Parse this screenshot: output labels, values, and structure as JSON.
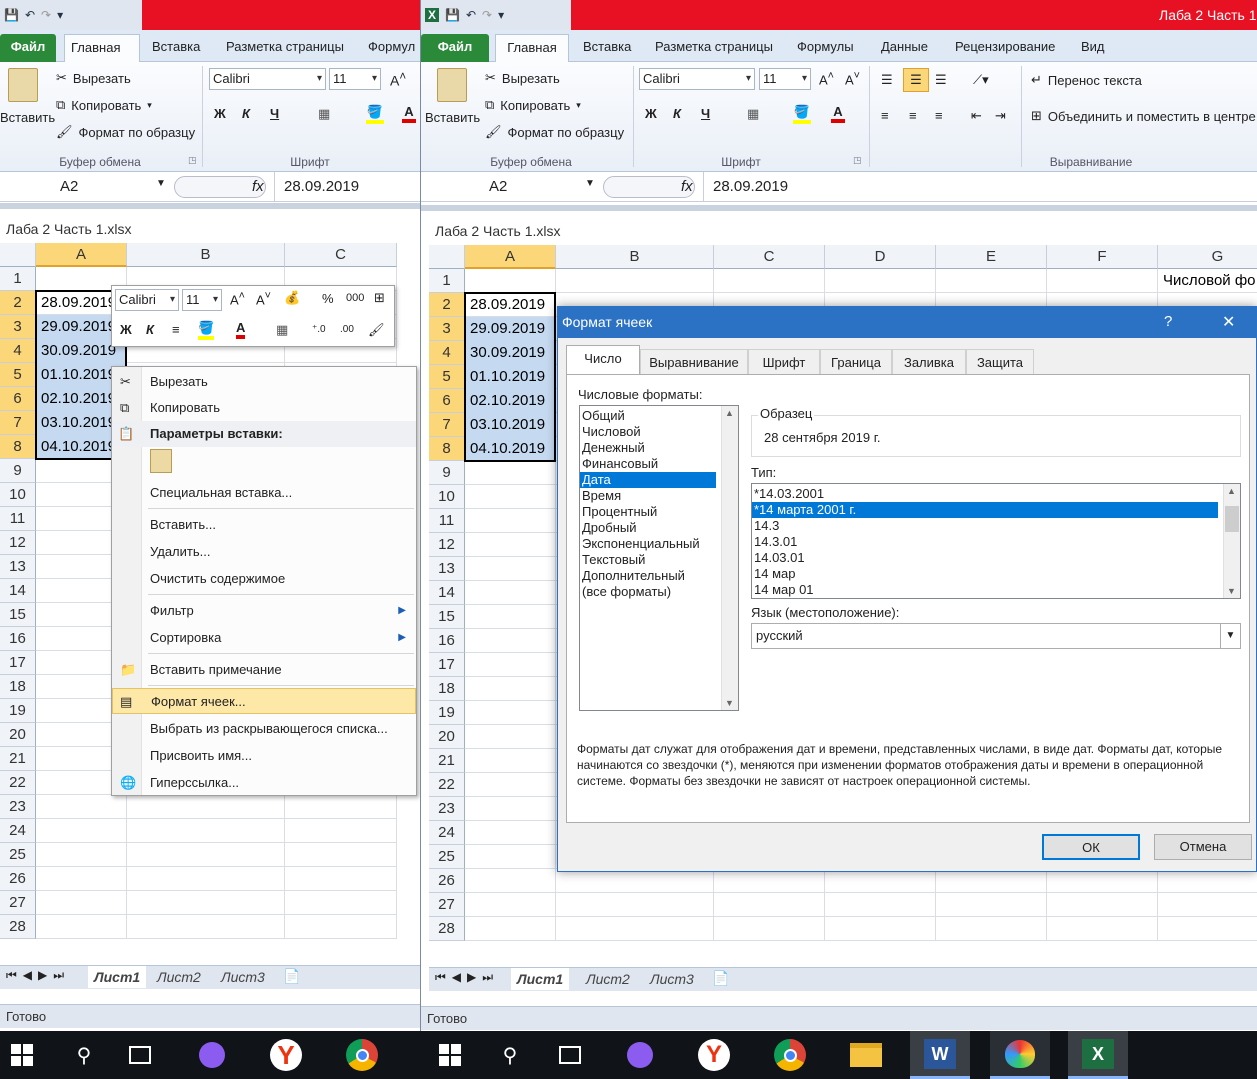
{
  "left": {
    "ribbon_tabs": [
      "Файл",
      "Главная",
      "Вставка",
      "Разметка страницы",
      "Формул"
    ],
    "clipboard": {
      "paste": "Вставить",
      "cut": "Вырезать",
      "copy": "Копировать",
      "format_painter": "Формат по образцу",
      "group": "Буфер обмена"
    },
    "font": {
      "name": "Calibri",
      "size": "11",
      "bold": "Ж",
      "italic": "К",
      "underline": "Ч",
      "group": "Шрифт"
    },
    "name_box": "A2",
    "fx": "fx",
    "formula": "28.09.2019",
    "workbook_title": "Лаба 2 Часть 1.xlsx",
    "columns": [
      "A",
      "B",
      "C"
    ],
    "rows": [
      "1",
      "2",
      "3",
      "4",
      "5",
      "6",
      "7",
      "8",
      "9",
      "10",
      "11",
      "12",
      "13",
      "14",
      "15",
      "16",
      "17",
      "18",
      "19",
      "20",
      "21",
      "22",
      "23",
      "24",
      "25",
      "26",
      "27",
      "28"
    ],
    "cells": [
      "28.09.2019",
      "29.09.2019",
      "30.09.2019",
      "01.10.2019",
      "02.10.2019",
      "03.10.2019",
      "04.10.2019"
    ],
    "sheet_tabs": [
      "Лист1",
      "Лист2",
      "Лист3"
    ],
    "status": "Готово",
    "mini_toolbar": {
      "font": "Calibri",
      "size": "11",
      "percent": "%",
      "thousands": "000",
      "bold": "Ж",
      "italic": "К"
    },
    "context_menu": [
      "Вырезать",
      "Копировать",
      "Параметры вставки:",
      "Специальная вставка...",
      "Вставить...",
      "Удалить...",
      "Очистить содержимое",
      "Фильтр",
      "Сортировка",
      "Вставить примечание",
      "Формат ячеек...",
      "Выбрать из раскрывающегося списка...",
      "Присвоить имя...",
      "Гиперссылка..."
    ]
  },
  "right": {
    "window_title": "Лаба 2 Часть 1",
    "ribbon_tabs": [
      "Файл",
      "Главная",
      "Вставка",
      "Разметка страницы",
      "Формулы",
      "Данные",
      "Рецензирование",
      "Вид"
    ],
    "clipboard": {
      "paste": "Вставить",
      "cut": "Вырезать",
      "copy": "Копировать",
      "format_painter": "Формат по образцу",
      "group": "Буфер обмена"
    },
    "font": {
      "name": "Calibri",
      "size": "11",
      "bold": "Ж",
      "italic": "К",
      "underline": "Ч",
      "group": "Шрифт"
    },
    "alignment": {
      "wrap": "Перенос текста",
      "merge": "Объединить и поместить в центре",
      "group": "Выравнивание"
    },
    "name_box": "A2",
    "fx": "fx",
    "formula": "28.09.2019",
    "workbook_title": "Лаба 2 Часть 1.xlsx",
    "columns": [
      "A",
      "B",
      "C",
      "D",
      "E",
      "F",
      "G"
    ],
    "rows": [
      "1",
      "2",
      "3",
      "4",
      "5",
      "6",
      "7",
      "8",
      "9",
      "10",
      "11",
      "12",
      "13",
      "14",
      "15",
      "16",
      "17",
      "18",
      "19",
      "20",
      "21",
      "22",
      "23",
      "24",
      "25",
      "26",
      "27",
      "28"
    ],
    "cells": [
      "28.09.2019",
      "29.09.2019",
      "30.09.2019",
      "01.10.2019",
      "02.10.2019",
      "03.10.2019",
      "04.10.2019"
    ],
    "g1": "Числовой фо",
    "sheet_tabs": [
      "Лист1",
      "Лист2",
      "Лист3"
    ],
    "status": "Готово"
  },
  "dialog": {
    "title": "Формат ячеек",
    "help": "?",
    "close": "✕",
    "tabs": [
      "Число",
      "Выравнивание",
      "Шрифт",
      "Граница",
      "Заливка",
      "Защита"
    ],
    "categories_label": "Числовые форматы:",
    "categories": [
      "Общий",
      "Числовой",
      "Денежный",
      "Финансовый",
      "Дата",
      "Время",
      "Процентный",
      "Дробный",
      "Экспоненциальный",
      "Текстовый",
      "Дополнительный",
      "(все форматы)"
    ],
    "selected_category": "Дата",
    "sample_label": "Образец",
    "sample_value": "28 сентября 2019 г.",
    "type_label": "Тип:",
    "types": [
      "*14.03.2001",
      "*14 марта 2001 г.",
      "14.3",
      "14.3.01",
      "14.03.01",
      "14 мар",
      "14 мар 01"
    ],
    "selected_type": "*14 марта 2001 г.",
    "locale_label": "Язык (местоположение):",
    "locale_value": "русский",
    "description": "Форматы дат служат для отображения дат и времени, представленных числами, в виде дат. Форматы дат, которые начинаются со звездочки (*), меняются при изменении форматов отображения даты и времени в операционной системе. Форматы без звездочки не зависят от настроек операционной системы.",
    "ok": "ОК",
    "cancel": "Отмена"
  },
  "colors": {
    "accent": "#2b72c4",
    "file_tab": "#2a8a3a",
    "selection": "#c5d9f1",
    "header_sel": "#fbd779",
    "titlebar": "#e81123"
  }
}
